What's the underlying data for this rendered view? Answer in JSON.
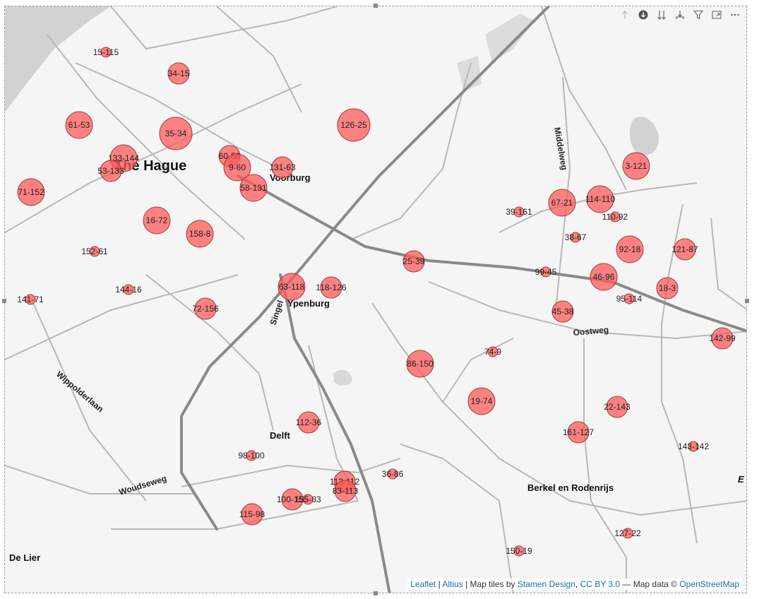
{
  "toolbar": {
    "icons": [
      "drill-up-icon",
      "drill-down-icon",
      "expand-all-icon",
      "expand-next-icon",
      "filter-icon",
      "focus-mode-icon",
      "more-options-icon"
    ]
  },
  "places": [
    {
      "name": "The Hague"
    },
    {
      "name": "Voorburg"
    },
    {
      "name": "Ypenburg"
    },
    {
      "name": "Delft"
    },
    {
      "name": "Berkel en Rodenrijs"
    },
    {
      "name": "De Lier"
    },
    {
      "name": "E"
    }
  ],
  "roads": [
    {
      "name": "Middelweg"
    },
    {
      "name": "Oostweg"
    },
    {
      "name": "Wippolderlaan"
    },
    {
      "name": "Woudseweg"
    },
    {
      "name": "Singel"
    }
  ],
  "markers": [
    {
      "label": "15-115",
      "size": 1
    },
    {
      "label": "34-15",
      "size": 2
    },
    {
      "label": "61-53",
      "size": 3
    },
    {
      "label": "35-34",
      "size": 4
    },
    {
      "label": "126-25",
      "size": 4
    },
    {
      "label": "133-144",
      "size": 3
    },
    {
      "label": "53-133",
      "size": 2
    },
    {
      "label": "60-58",
      "size": 2
    },
    {
      "label": "9-60",
      "size": 3
    },
    {
      "label": "131-63",
      "size": 2
    },
    {
      "label": "58-131",
      "size": 3
    },
    {
      "label": "71-152",
      "size": 3
    },
    {
      "label": "16-72",
      "size": 3
    },
    {
      "label": "158-8",
      "size": 3
    },
    {
      "label": "152-61",
      "size": 1
    },
    {
      "label": "144-16",
      "size": 1
    },
    {
      "label": "141-71",
      "size": 1
    },
    {
      "label": "72-156",
      "size": 2
    },
    {
      "label": "63-118",
      "size": 3
    },
    {
      "label": "118-126",
      "size": 2
    },
    {
      "label": "25-39",
      "size": 2
    },
    {
      "label": "3-121",
      "size": 3
    },
    {
      "label": "67-21",
      "size": 3
    },
    {
      "label": "114-110",
      "size": 3
    },
    {
      "label": "110-92",
      "size": 1
    },
    {
      "label": "39-161",
      "size": 1
    },
    {
      "label": "38-67",
      "size": 1
    },
    {
      "label": "92-18",
      "size": 3
    },
    {
      "label": "121-87",
      "size": 2
    },
    {
      "label": "99-45",
      "size": 1
    },
    {
      "label": "46-96",
      "size": 3
    },
    {
      "label": "18-3",
      "size": 2
    },
    {
      "label": "95-114",
      "size": 1
    },
    {
      "label": "45-38",
      "size": 2
    },
    {
      "label": "142-99",
      "size": 2
    },
    {
      "label": "74-9",
      "size": 1
    },
    {
      "label": "86-150",
      "size": 3
    },
    {
      "label": "19-74",
      "size": 3
    },
    {
      "label": "22-143",
      "size": 2
    },
    {
      "label": "112-36",
      "size": 2
    },
    {
      "label": "161-127",
      "size": 2
    },
    {
      "label": "143-142",
      "size": 1
    },
    {
      "label": "98-100",
      "size": 1
    },
    {
      "label": "36-86",
      "size": 1
    },
    {
      "label": "113-112",
      "size": 2
    },
    {
      "label": "83-113",
      "size": 2
    },
    {
      "label": "100-155",
      "size": 2
    },
    {
      "label": "155-83",
      "size": 1
    },
    {
      "label": "115-98",
      "size": 2
    },
    {
      "label": "127-22",
      "size": 1
    },
    {
      "label": "150-19",
      "size": 1
    }
  ],
  "colors": {
    "marker_fill": "#ff5a5a",
    "marker_stroke": "#a33a3a",
    "road": "#8a8a8a",
    "road_minor": "#b5b5b5",
    "land": "#f5f5f5",
    "water": "#d2d2d2"
  },
  "attribution": {
    "leaflet": "Leaflet",
    "sep1": " | ",
    "altius": "Altius",
    "tiles_text": " | Map tiles by ",
    "stamen": "Stamen Design",
    "comma": ", ",
    "license": "CC BY 3.0",
    "mapdata_text": " — Map data © ",
    "osm": "OpenStreetMap"
  }
}
